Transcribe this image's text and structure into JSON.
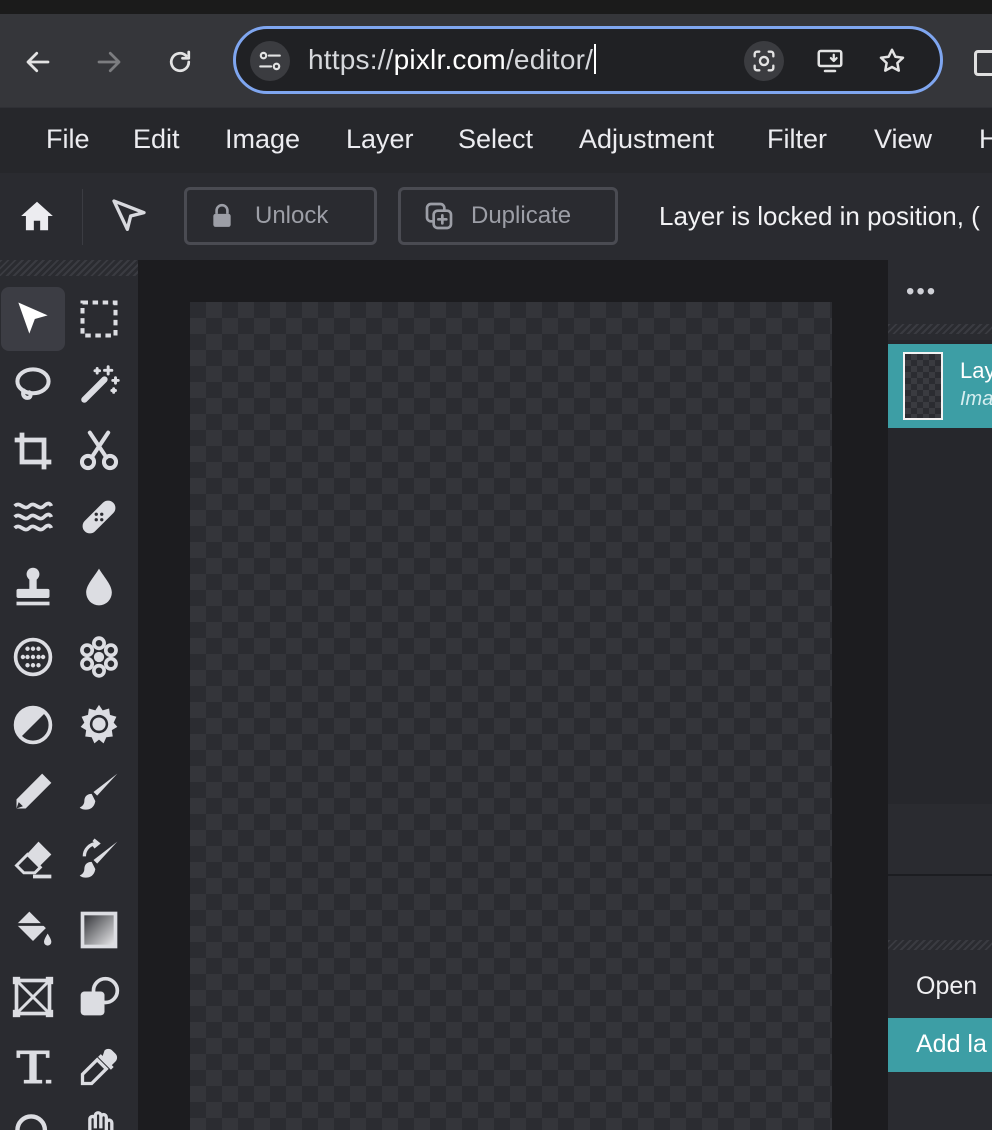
{
  "browser": {
    "url_scheme": "https://",
    "url_host": "pixlr.com",
    "url_path": "/editor/"
  },
  "menu": [
    "File",
    "Edit",
    "Image",
    "Layer",
    "Select",
    "Adjustment",
    "Filter",
    "View",
    "H"
  ],
  "options": {
    "unlock_label": "Unlock",
    "duplicate_label": "Duplicate",
    "status_message": "Layer is locked in position, ("
  },
  "tools": [
    {
      "name": "arrange-tool",
      "icon": "pointer-arrow-icon",
      "active": true
    },
    {
      "name": "marquee-tool",
      "icon": "dashed-rectangle-icon"
    },
    {
      "name": "lasso-tool",
      "icon": "lasso-icon"
    },
    {
      "name": "wand-tool",
      "icon": "magic-wand-icon"
    },
    {
      "name": "crop-tool",
      "icon": "crop-icon"
    },
    {
      "name": "cutout-tool",
      "icon": "scissors-icon"
    },
    {
      "name": "liquify-tool",
      "icon": "wave-icon"
    },
    {
      "name": "heal-tool",
      "icon": "bandage-icon"
    },
    {
      "name": "clone-tool",
      "icon": "stamp-icon"
    },
    {
      "name": "blur-tool",
      "icon": "drop-icon"
    },
    {
      "name": "sponge-tool",
      "icon": "dotted-circle-icon"
    },
    {
      "name": "dodge-tool",
      "icon": "flower-icon"
    },
    {
      "name": "burn-tool",
      "icon": "half-circle-icon"
    },
    {
      "name": "sharpen-tool",
      "icon": "gear-sun-icon"
    },
    {
      "name": "pencil-tool",
      "icon": "pen-icon"
    },
    {
      "name": "brush-tool",
      "icon": "brush-icon"
    },
    {
      "name": "eraser-tool",
      "icon": "eraser-icon"
    },
    {
      "name": "replace-color-tool",
      "icon": "brush-swap-icon"
    },
    {
      "name": "fill-tool",
      "icon": "paint-bucket-icon"
    },
    {
      "name": "gradient-tool",
      "icon": "gradient-square-icon"
    },
    {
      "name": "shape-tool",
      "icon": "frame-x-icon"
    },
    {
      "name": "element-tool",
      "icon": "shapes-icon"
    },
    {
      "name": "text-tool",
      "icon": "text-icon"
    },
    {
      "name": "eyedropper-tool",
      "icon": "eyedropper-icon"
    },
    {
      "name": "zoom-tool",
      "icon": "magnifier-icon"
    },
    {
      "name": "hand-tool",
      "icon": "hand-icon"
    }
  ],
  "layers_panel": {
    "menu_glyph": "•••",
    "layer": {
      "name": "Lay",
      "type": "Ima"
    },
    "open_label": "Open",
    "add_layer_label": "Add la"
  }
}
